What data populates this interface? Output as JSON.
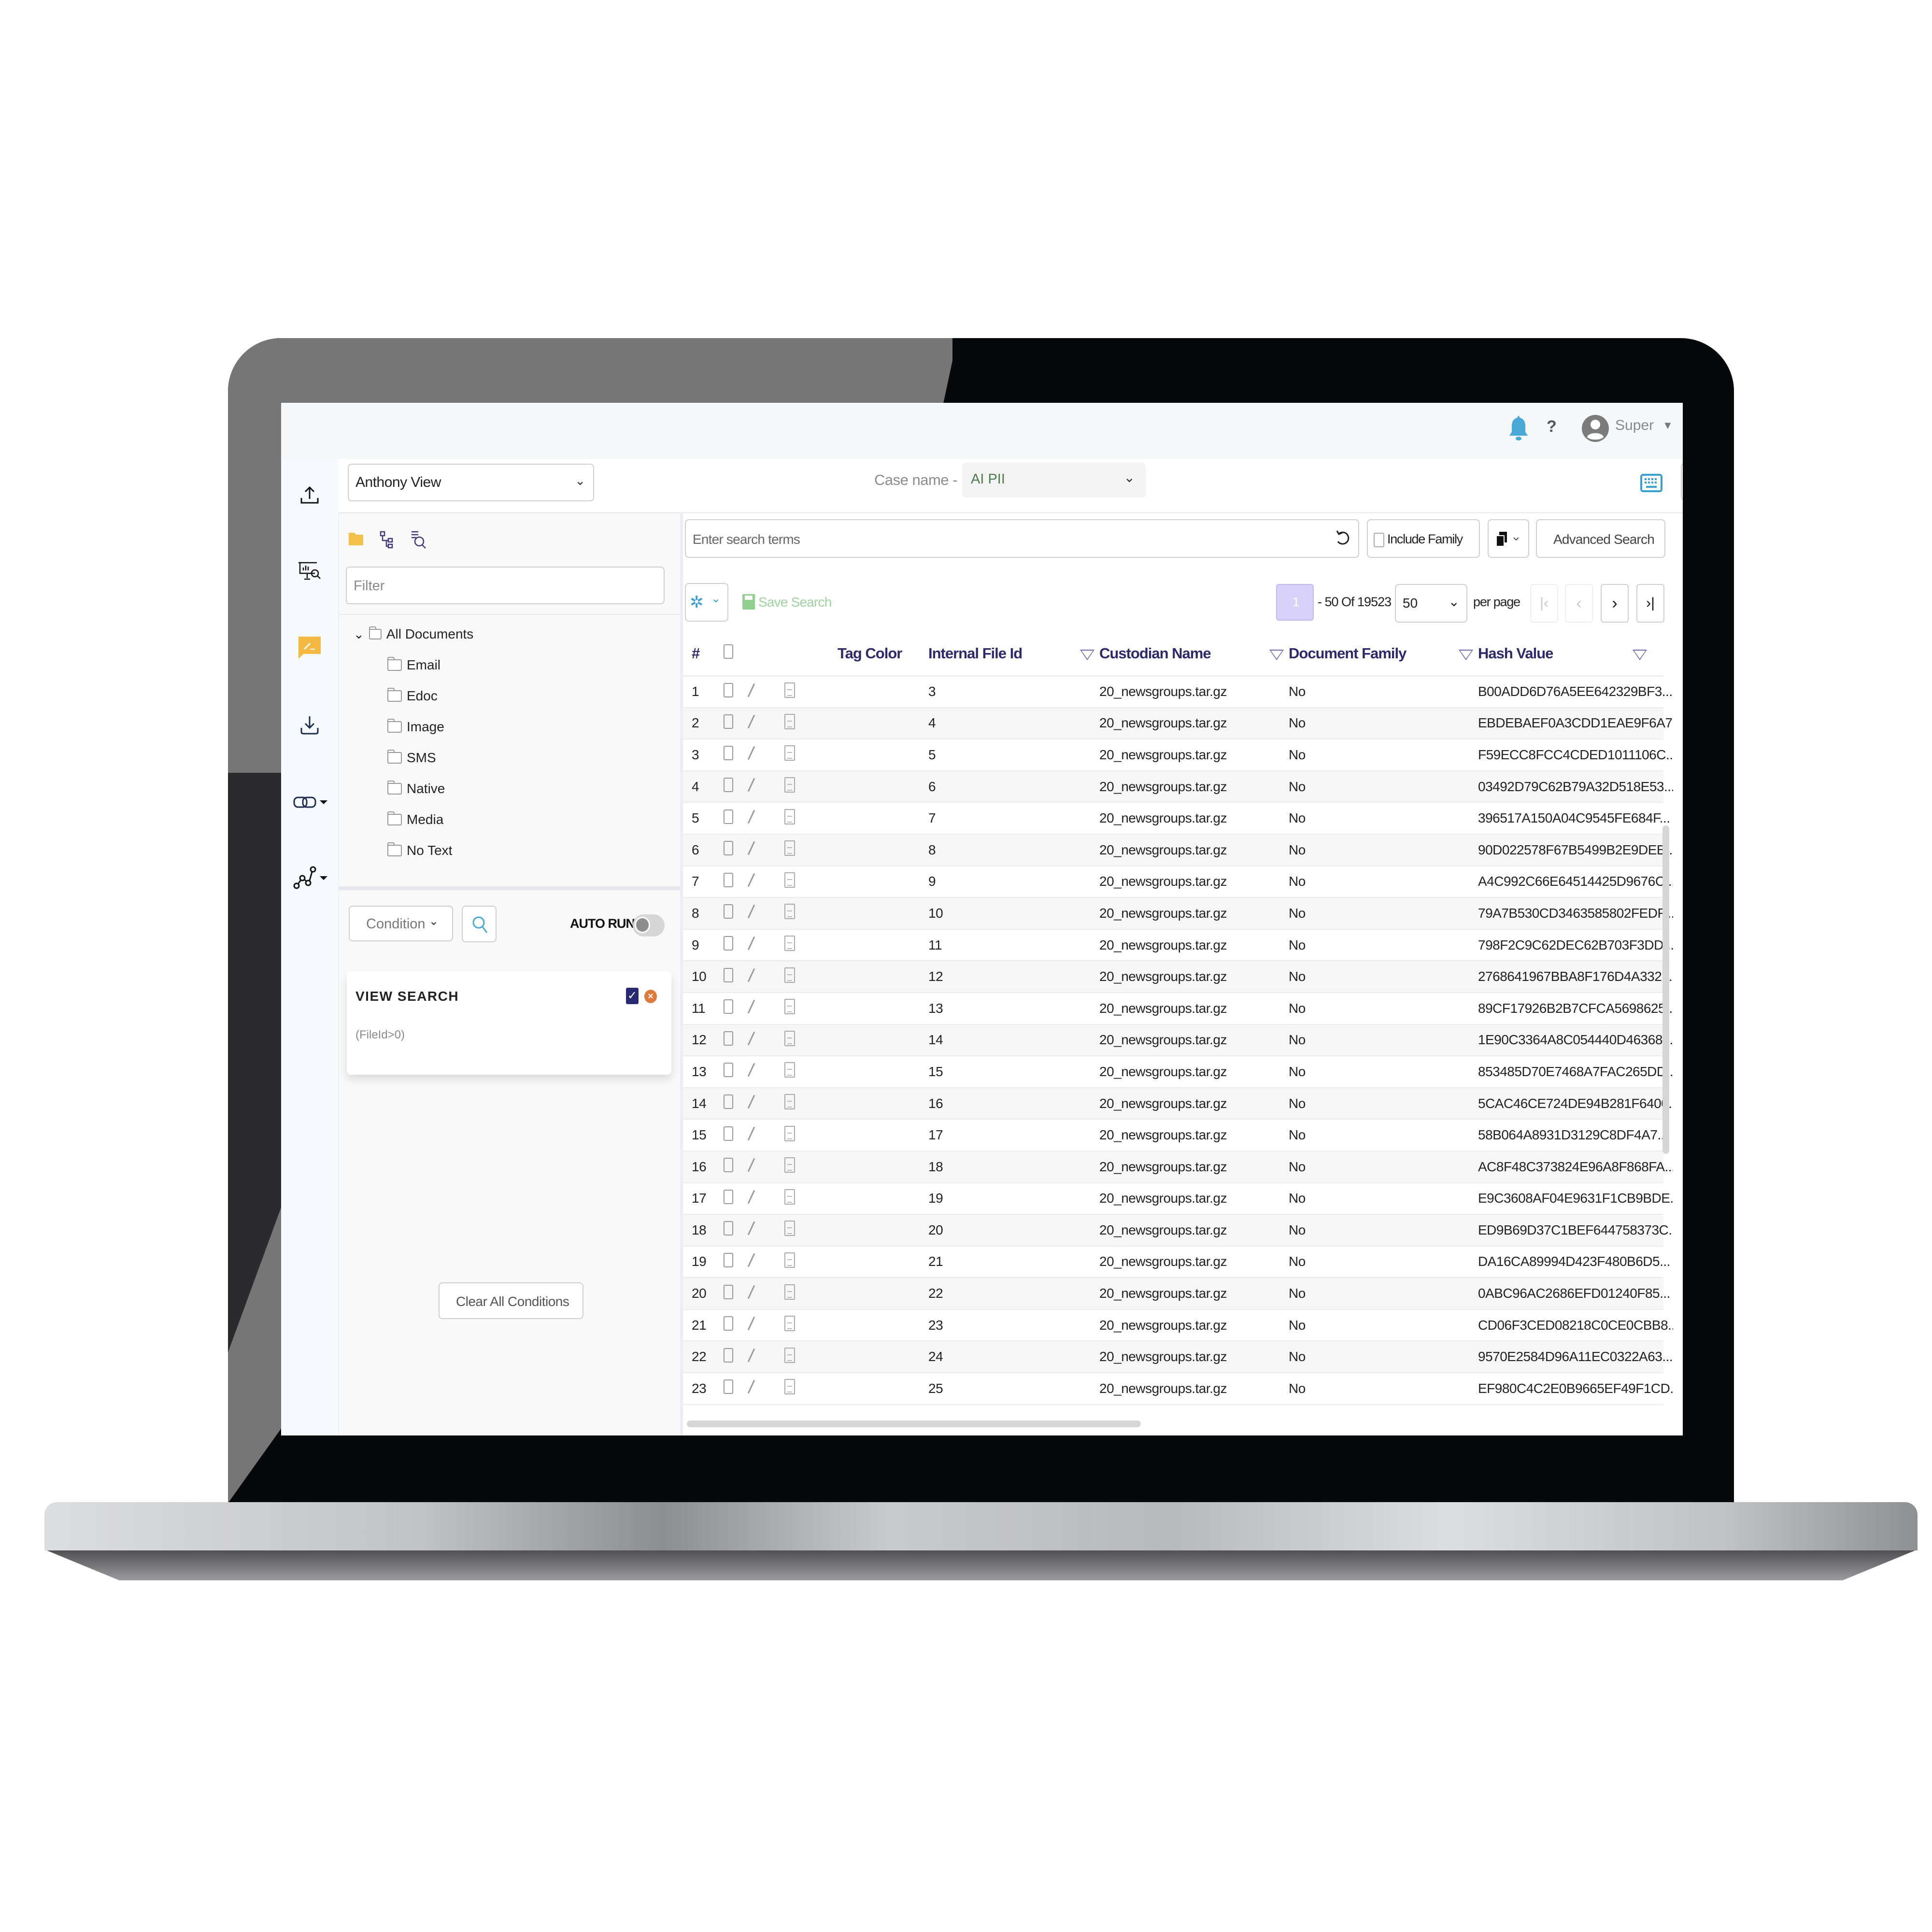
{
  "topbar": {
    "user_name": "Super",
    "icons": [
      "bell-icon",
      "help-icon",
      "user-avatar-icon",
      "caret-down-icon"
    ]
  },
  "rail": {
    "items": [
      {
        "name": "upload-icon"
      },
      {
        "name": "presentation-search-icon"
      },
      {
        "name": "comment-edit-icon",
        "active": true
      },
      {
        "name": "download-icon"
      },
      {
        "name": "link-icon",
        "has_dropdown": true
      },
      {
        "name": "graph-nodes-icon",
        "has_dropdown": true
      }
    ]
  },
  "view_select": {
    "value": "Anthony View"
  },
  "case": {
    "label": "Case name -",
    "value": "AI PII"
  },
  "tools": {
    "icons": [
      "keyboard-icon",
      "history-icon"
    ]
  },
  "left_panel": {
    "toolbar_icons": [
      "folder-icon",
      "tree-structure-icon",
      "list-search-icon"
    ],
    "filter_placeholder": "Filter",
    "tree": {
      "root": "All Documents",
      "children": [
        "Email",
        "Edoc",
        "Image",
        "SMS",
        "Native",
        "Media",
        "No Text"
      ]
    },
    "condition_button": "Condition",
    "auto_run_label": "AUTO RUN",
    "auto_run_on": false,
    "view_search": {
      "title": "VIEW SEARCH",
      "query": "(FileId>0)",
      "checked": true
    },
    "clear_button": "Clear All Conditions"
  },
  "search": {
    "placeholder": "Enter search terms",
    "include_family_label": "Include Family",
    "include_family_checked": false,
    "advanced_search_label": "Advanced Search",
    "save_search_label": "Save Search"
  },
  "pagination": {
    "current_page": "1",
    "range_text": "- 50 Of 19523",
    "per_page_value": "50",
    "per_page_label": "per page"
  },
  "table": {
    "columns": [
      "#",
      "",
      "Tag Color",
      "Internal File Id",
      "Custodian Name",
      "Document Family",
      "Hash Value"
    ],
    "rows": [
      {
        "n": "1",
        "id": "3",
        "custodian": "20_newsgroups.tar.gz",
        "family": "No",
        "hash": "B00ADD6D76A5EE642329BF3..."
      },
      {
        "n": "2",
        "id": "4",
        "custodian": "20_newsgroups.tar.gz",
        "family": "No",
        "hash": "EBDEBAEF0A3CDD1EAE9F6A7..."
      },
      {
        "n": "3",
        "id": "5",
        "custodian": "20_newsgroups.tar.gz",
        "family": "No",
        "hash": "F59ECC8FCC4CDED1011106C..."
      },
      {
        "n": "4",
        "id": "6",
        "custodian": "20_newsgroups.tar.gz",
        "family": "No",
        "hash": "03492D79C62B79A32D518E53..."
      },
      {
        "n": "5",
        "id": "7",
        "custodian": "20_newsgroups.tar.gz",
        "family": "No",
        "hash": "396517A150A04C9545FE684F..."
      },
      {
        "n": "6",
        "id": "8",
        "custodian": "20_newsgroups.tar.gz",
        "family": "No",
        "hash": "90D022578F67B5499B2E9DEB..."
      },
      {
        "n": "7",
        "id": "9",
        "custodian": "20_newsgroups.tar.gz",
        "family": "No",
        "hash": "A4C992C66E64514425D9676C..."
      },
      {
        "n": "8",
        "id": "10",
        "custodian": "20_newsgroups.tar.gz",
        "family": "No",
        "hash": "79A7B530CD3463585802FEDF..."
      },
      {
        "n": "9",
        "id": "11",
        "custodian": "20_newsgroups.tar.gz",
        "family": "No",
        "hash": "798F2C9C62DEC62B703F3DD..."
      },
      {
        "n": "10",
        "id": "12",
        "custodian": "20_newsgroups.tar.gz",
        "family": "No",
        "hash": "2768641967BBA8F176D4A332..."
      },
      {
        "n": "11",
        "id": "13",
        "custodian": "20_newsgroups.tar.gz",
        "family": "No",
        "hash": "89CF17926B2B7CFCA5698625..."
      },
      {
        "n": "12",
        "id": "14",
        "custodian": "20_newsgroups.tar.gz",
        "family": "No",
        "hash": "1E90C3364A8C054440D46368..."
      },
      {
        "n": "13",
        "id": "15",
        "custodian": "20_newsgroups.tar.gz",
        "family": "No",
        "hash": "853485D70E7468A7FAC265DD..."
      },
      {
        "n": "14",
        "id": "16",
        "custodian": "20_newsgroups.tar.gz",
        "family": "No",
        "hash": "5CAC46CE724DE94B281F6400..."
      },
      {
        "n": "15",
        "id": "17",
        "custodian": "20_newsgroups.tar.gz",
        "family": "No",
        "hash": "58B064A8931D3129C8DF4A7..."
      },
      {
        "n": "16",
        "id": "18",
        "custodian": "20_newsgroups.tar.gz",
        "family": "No",
        "hash": "AC8F48C373824E96A8F868FA..."
      },
      {
        "n": "17",
        "id": "19",
        "custodian": "20_newsgroups.tar.gz",
        "family": "No",
        "hash": "E9C3608AF04E9631F1CB9BDE..."
      },
      {
        "n": "18",
        "id": "20",
        "custodian": "20_newsgroups.tar.gz",
        "family": "No",
        "hash": "ED9B69D37C1BEF644758373C..."
      },
      {
        "n": "19",
        "id": "21",
        "custodian": "20_newsgroups.tar.gz",
        "family": "No",
        "hash": "DA16CA89994D423F480B6D5..."
      },
      {
        "n": "20",
        "id": "22",
        "custodian": "20_newsgroups.tar.gz",
        "family": "No",
        "hash": "0ABC96AC2686EFD01240F85..."
      },
      {
        "n": "21",
        "id": "23",
        "custodian": "20_newsgroups.tar.gz",
        "family": "No",
        "hash": "CD06F3CED08218C0CE0CBB8..."
      },
      {
        "n": "22",
        "id": "24",
        "custodian": "20_newsgroups.tar.gz",
        "family": "No",
        "hash": "9570E2584D96A11EC0322A63..."
      },
      {
        "n": "23",
        "id": "25",
        "custodian": "20_newsgroups.tar.gz",
        "family": "No",
        "hash": "EF980C4C2E0B9665EF49F1CD..."
      }
    ]
  },
  "colors": {
    "accent_blue": "#4aa8d8",
    "header_navy": "#2d2a6b",
    "active_yellow": "#f3b941",
    "page_badge": "#d8d2fb",
    "save_green": "#8fd08f",
    "close_orange": "#e07a3a",
    "check_navy": "#2a2a72"
  }
}
